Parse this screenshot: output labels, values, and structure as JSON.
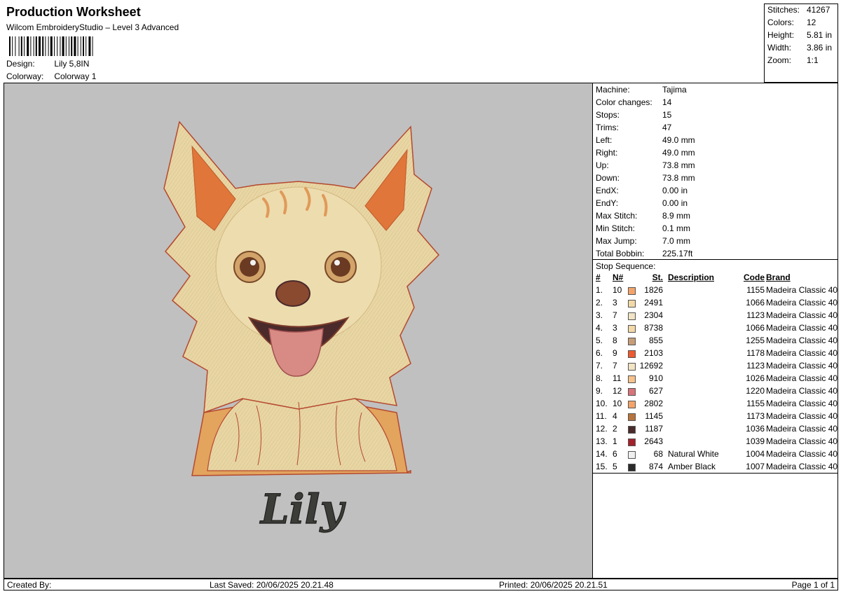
{
  "header": {
    "title": "Production Worksheet",
    "software": "Wilcom EmbroideryStudio – Level 3 Advanced",
    "design_label": "Design:",
    "design_value": "Lily 5,8IN",
    "colorway_label": "Colorway:",
    "colorway_value": "Colorway 1"
  },
  "summary": [
    {
      "label": "Stitches:",
      "value": "41267"
    },
    {
      "label": "Colors:",
      "value": "12"
    },
    {
      "label": "Height:",
      "value": "5.81 in"
    },
    {
      "label": "Width:",
      "value": "3.86 in"
    },
    {
      "label": "Zoom:",
      "value": "1:1"
    }
  ],
  "preview": {
    "caption": "Lily",
    "colors": {
      "background": "#c0c0c0",
      "fur": "#e8d6a4",
      "outline": "#b5482e",
      "inner_ear": "#e0763a",
      "tongue": "#d88a84",
      "text": "#3c3c38"
    }
  },
  "machine": [
    {
      "label": "Machine:",
      "value": "Tajima"
    },
    {
      "label": "Color changes:",
      "value": "14"
    },
    {
      "label": "Stops:",
      "value": "15"
    },
    {
      "label": "Trims:",
      "value": "47"
    },
    {
      "label": "Left:",
      "value": "49.0 mm"
    },
    {
      "label": "Right:",
      "value": "49.0 mm"
    },
    {
      "label": "Up:",
      "value": "73.8 mm"
    },
    {
      "label": "Down:",
      "value": "73.8 mm"
    },
    {
      "label": "EndX:",
      "value": "0.00 in"
    },
    {
      "label": "EndY:",
      "value": "0.00 in"
    },
    {
      "label": "Max Stitch:",
      "value": "8.9 mm"
    },
    {
      "label": "Min Stitch:",
      "value": "0.1 mm"
    },
    {
      "label": "Max Jump:",
      "value": "7.0 mm"
    },
    {
      "label": "Total Bobbin:",
      "value": "225.17ft"
    }
  ],
  "stop_sequence": {
    "title": "Stop Sequence:",
    "columns": {
      "num": "#",
      "n": "N#",
      "st": "St.",
      "desc": "Description",
      "code": "Code",
      "brand": "Brand"
    },
    "rows": [
      {
        "num": "1.",
        "n": "10",
        "color": "#f4a46a",
        "st": "1826",
        "desc": "",
        "code": "1155",
        "brand": "Madeira Classic 40"
      },
      {
        "num": "2.",
        "n": "3",
        "color": "#f3d9a8",
        "st": "2491",
        "desc": "",
        "code": "1066",
        "brand": "Madeira Classic 40"
      },
      {
        "num": "3.",
        "n": "7",
        "color": "#f2e4c4",
        "st": "2304",
        "desc": "",
        "code": "1123",
        "brand": "Madeira Classic 40"
      },
      {
        "num": "4.",
        "n": "3",
        "color": "#f3d9a8",
        "st": "8738",
        "desc": "",
        "code": "1066",
        "brand": "Madeira Classic 40"
      },
      {
        "num": "5.",
        "n": "8",
        "color": "#c79d78",
        "st": "855",
        "desc": "",
        "code": "1255",
        "brand": "Madeira Classic 40"
      },
      {
        "num": "6.",
        "n": "9",
        "color": "#ef5a2e",
        "st": "2103",
        "desc": "",
        "code": "1178",
        "brand": "Madeira Classic 40"
      },
      {
        "num": "7.",
        "n": "7",
        "color": "#f2e4c4",
        "st": "12692",
        "desc": "",
        "code": "1123",
        "brand": "Madeira Classic 40"
      },
      {
        "num": "8.",
        "n": "11",
        "color": "#f7c28c",
        "st": "910",
        "desc": "",
        "code": "1026",
        "brand": "Madeira Classic 40"
      },
      {
        "num": "9.",
        "n": "12",
        "color": "#d9737a",
        "st": "627",
        "desc": "",
        "code": "1220",
        "brand": "Madeira Classic 40"
      },
      {
        "num": "10.",
        "n": "10",
        "color": "#f4a46a",
        "st": "2802",
        "desc": "",
        "code": "1155",
        "brand": "Madeira Classic 40"
      },
      {
        "num": "11.",
        "n": "4",
        "color": "#b8743c",
        "st": "1145",
        "desc": "",
        "code": "1173",
        "brand": "Madeira Classic 40"
      },
      {
        "num": "12.",
        "n": "2",
        "color": "#4a2a2a",
        "st": "1187",
        "desc": "",
        "code": "1036",
        "brand": "Madeira Classic 40"
      },
      {
        "num": "13.",
        "n": "1",
        "color": "#a4202a",
        "st": "2643",
        "desc": "",
        "code": "1039",
        "brand": "Madeira Classic 40"
      },
      {
        "num": "14.",
        "n": "6",
        "color": "#efefef",
        "st": "68",
        "desc": "Natural White",
        "code": "1004",
        "brand": "Madeira Classic 40"
      },
      {
        "num": "15.",
        "n": "5",
        "color": "#2a2a2a",
        "st": "874",
        "desc": "Amber Black",
        "code": "1007",
        "brand": "Madeira Classic 40"
      }
    ]
  },
  "footer": {
    "created_by": "Created By:",
    "last_saved": "Last Saved: 20/06/2025 20.21.48",
    "printed": "Printed: 20/06/2025 20.21.51",
    "page": "Page 1 of 1"
  }
}
